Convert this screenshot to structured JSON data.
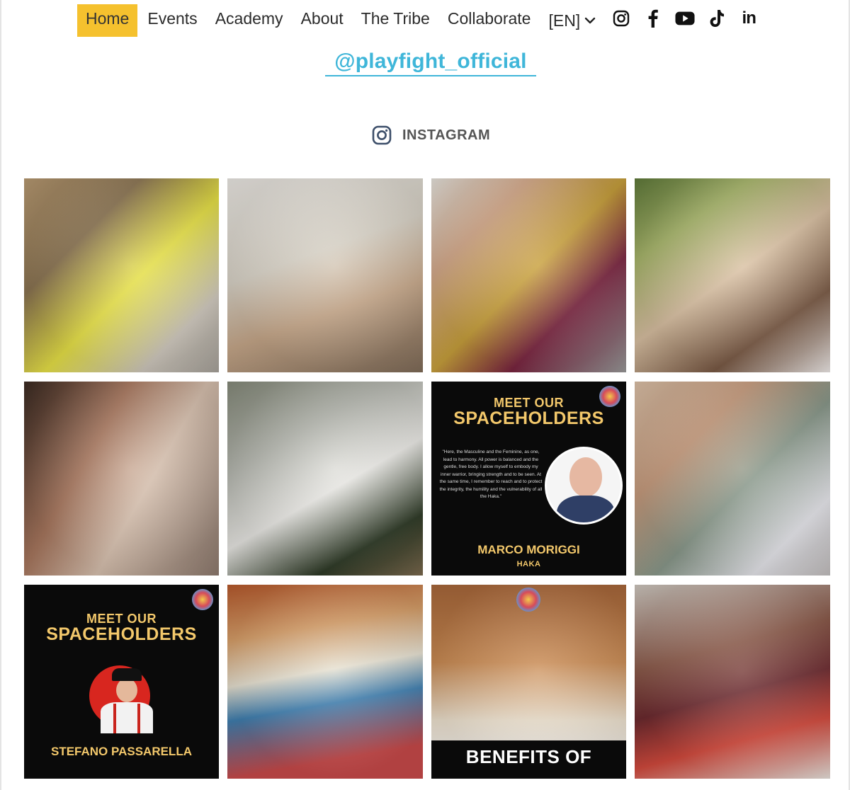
{
  "nav": {
    "items": [
      {
        "label": "Home",
        "active": true
      },
      {
        "label": "Events"
      },
      {
        "label": "Academy"
      },
      {
        "label": "About"
      },
      {
        "label": "The Tribe"
      },
      {
        "label": "Collaborate"
      }
    ],
    "language": "[EN]",
    "social_icons": [
      "instagram-icon",
      "facebook-icon",
      "youtube-icon",
      "tiktok-icon",
      "linkedin-icon"
    ],
    "linkedin_text": "in",
    "active_color": "#f5c12e"
  },
  "handle": "@playfight_official",
  "handle_color": "#3fb6d9",
  "instagram_label": "INSTAGRAM",
  "posts": {
    "p7": {
      "meet": "MEET OUR",
      "title": "SPACEHOLDERS",
      "quote": "\"Here, the Masculine and the Feminine, as one, lead to harmony. All power is balanced and the gentle, free body. I allow myself to embody my inner warrior, bringing strength and to be seen. At the same time, I remember to reach and to protect the integrity, the humility and the vulnerability of all the Haka.\"",
      "name": "MARCO MORIGGI",
      "sub": "HAKA"
    },
    "p9": {
      "meet": "MEET OUR",
      "title": "SPACEHOLDERS",
      "name": "STEFANO PASSARELLA"
    },
    "p11": {
      "banner": "BENEFITS OF"
    }
  }
}
